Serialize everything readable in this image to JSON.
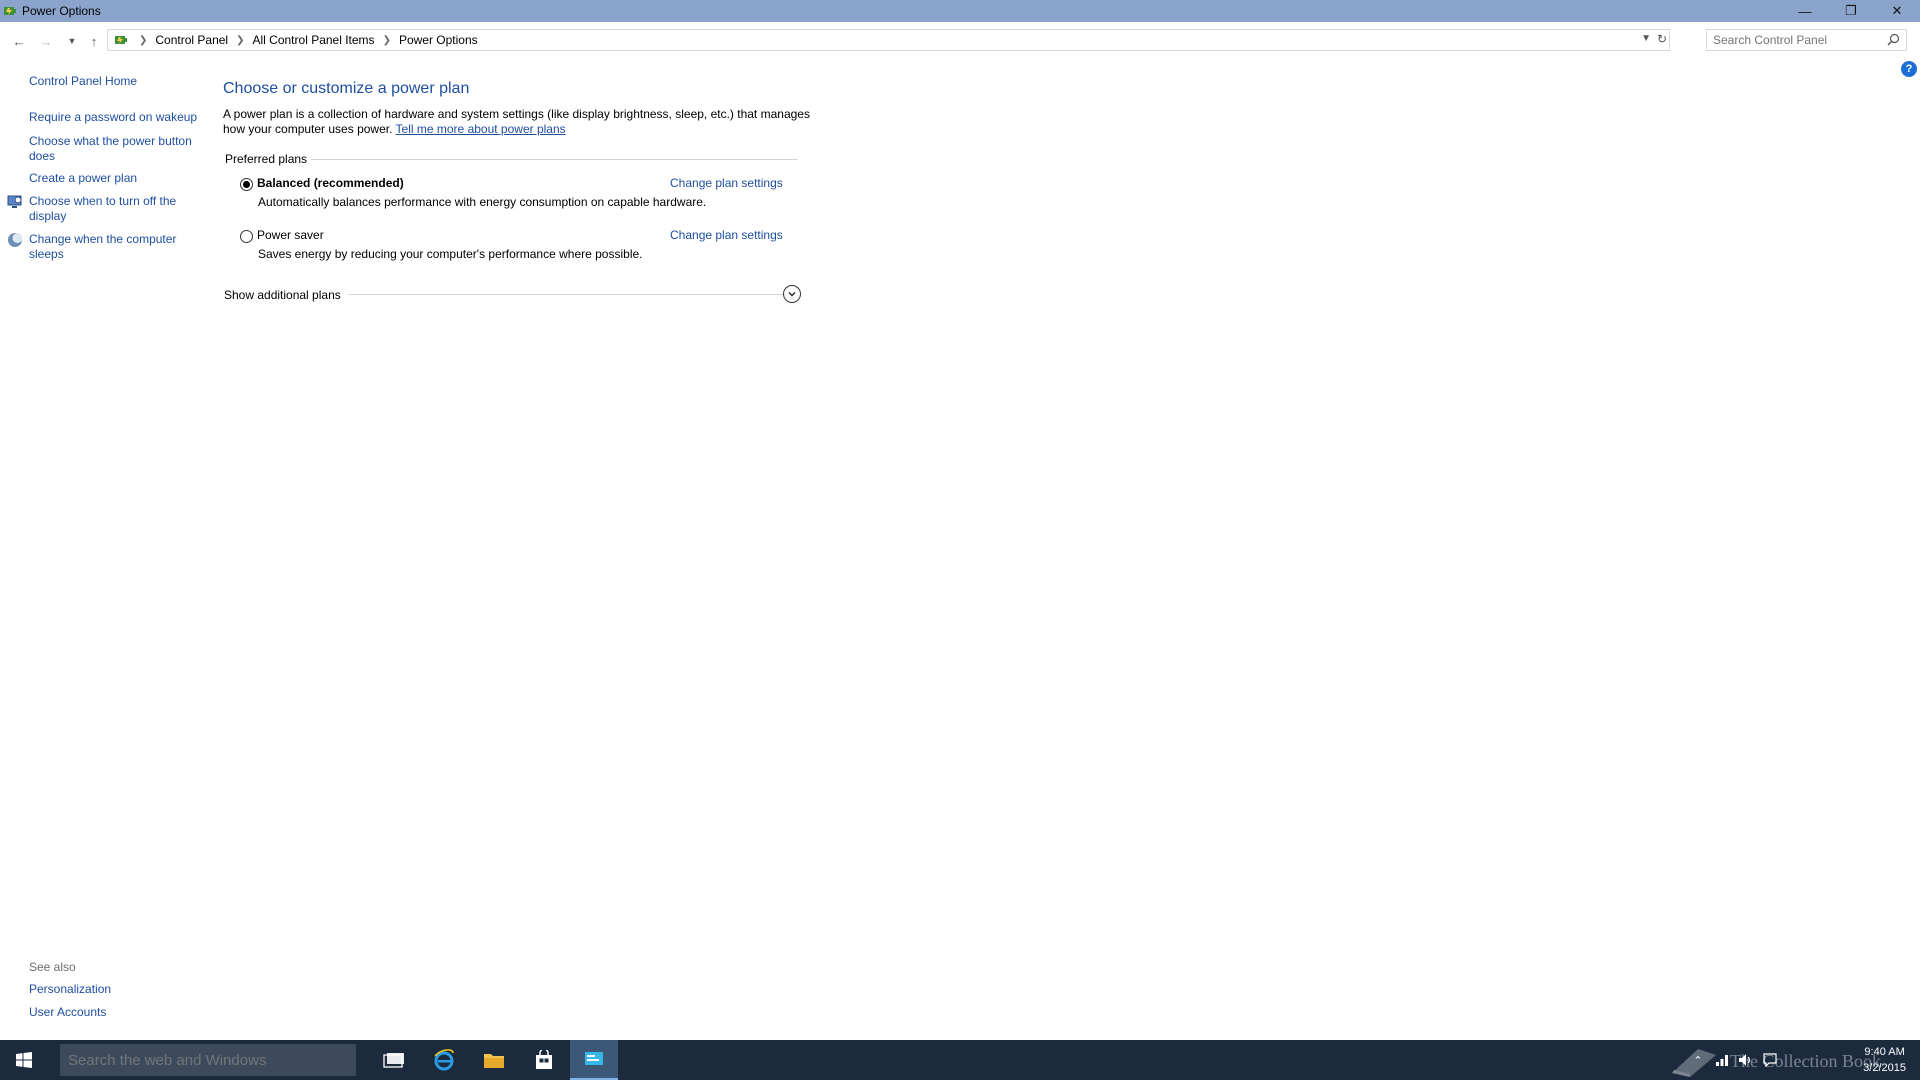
{
  "window": {
    "title": "Power Options"
  },
  "address": {
    "crumbs": [
      "Control Panel",
      "All Control Panel Items",
      "Power Options"
    ],
    "search_placeholder": "Search Control Panel"
  },
  "left_pane": {
    "home": "Control Panel Home",
    "links": [
      "Require a password on wakeup",
      "Choose what the power button does",
      "Create a power plan",
      "Choose when to turn off the display",
      "Change when the computer sleeps"
    ],
    "see_also_label": "See also",
    "see_also": [
      "Personalization",
      "User Accounts"
    ]
  },
  "main": {
    "heading": "Choose or customize a power plan",
    "description": "A power plan is a collection of hardware and system settings (like display brightness, sleep, etc.) that manages how your computer uses power.",
    "learn_more": "Tell me more about power plans",
    "preferred_label": "Preferred plans",
    "plans": [
      {
        "name": "Balanced (recommended)",
        "selected": true,
        "change_label": "Change plan settings",
        "description": "Automatically balances performance with energy consumption on capable hardware."
      },
      {
        "name": "Power saver",
        "selected": false,
        "change_label": "Change plan settings",
        "description": "Saves energy by reducing your computer's performance where possible."
      }
    ],
    "show_more": "Show additional plans"
  },
  "taskbar": {
    "search_placeholder": "Search the web and Windows",
    "watermark": "The Collection Book",
    "time": "9:40 AM",
    "date": "3/2/2015"
  },
  "colors": {
    "titlebar": "#8aa4cc",
    "link": "#1e4fa0",
    "taskbar": "#1c2a3d"
  }
}
